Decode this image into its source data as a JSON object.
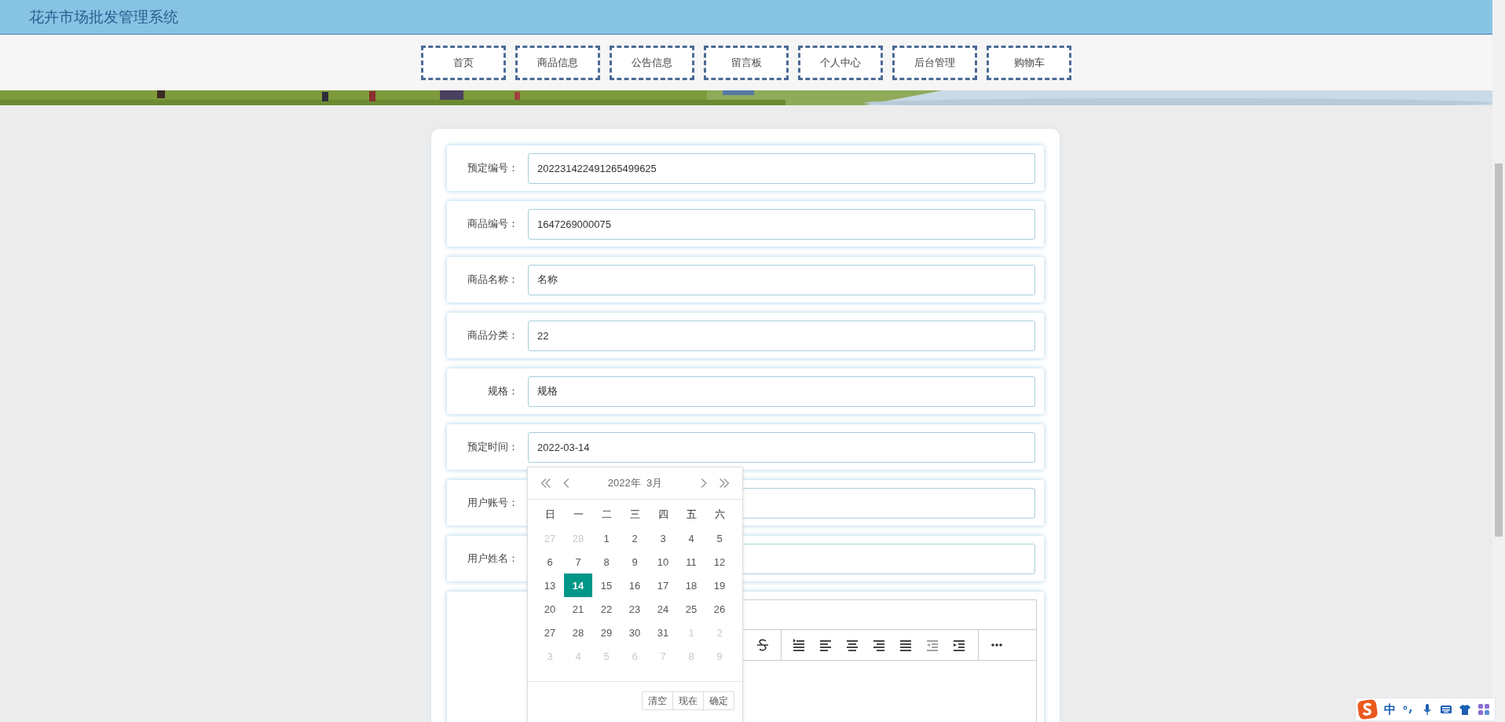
{
  "header": {
    "title": "花卉市场批发管理系统"
  },
  "nav": [
    {
      "label": "首页"
    },
    {
      "label": "商品信息"
    },
    {
      "label": "公告信息"
    },
    {
      "label": "留言板"
    },
    {
      "label": "个人中心"
    },
    {
      "label": "后台管理"
    },
    {
      "label": "购物车"
    }
  ],
  "form": {
    "fields": [
      {
        "label": "预定编号：",
        "value": "202231422491265499625"
      },
      {
        "label": "商品编号：",
        "value": "1647269000075"
      },
      {
        "label": "商品名称：",
        "value": "名称"
      },
      {
        "label": "商品分类：",
        "value": "22"
      },
      {
        "label": "规格：",
        "value": "规格"
      },
      {
        "label": "预定时间：",
        "value": "2022-03-14"
      },
      {
        "label": "用户账号："
      },
      {
        "label": "用户姓名："
      }
    ]
  },
  "date_picker": {
    "year_month": "2022年  3月",
    "weekdays": [
      "日",
      "一",
      "二",
      "三",
      "四",
      "五",
      "六"
    ],
    "days": [
      {
        "day": "27",
        "kind": "other",
        "selected": false
      },
      {
        "day": "28",
        "kind": "other",
        "selected": false
      },
      {
        "day": "1",
        "kind": "current",
        "selected": false
      },
      {
        "day": "2",
        "kind": "current",
        "selected": false
      },
      {
        "day": "3",
        "kind": "current",
        "selected": false
      },
      {
        "day": "4",
        "kind": "current",
        "selected": false
      },
      {
        "day": "5",
        "kind": "current",
        "selected": false
      },
      {
        "day": "6",
        "kind": "current",
        "selected": false
      },
      {
        "day": "7",
        "kind": "current",
        "selected": false
      },
      {
        "day": "8",
        "kind": "current",
        "selected": false
      },
      {
        "day": "9",
        "kind": "current",
        "selected": false
      },
      {
        "day": "10",
        "kind": "current",
        "selected": false
      },
      {
        "day": "11",
        "kind": "current",
        "selected": false
      },
      {
        "day": "12",
        "kind": "current",
        "selected": false
      },
      {
        "day": "13",
        "kind": "current",
        "selected": false
      },
      {
        "day": "14",
        "kind": "current",
        "selected": true
      },
      {
        "day": "15",
        "kind": "current",
        "selected": false
      },
      {
        "day": "16",
        "kind": "current",
        "selected": false
      },
      {
        "day": "17",
        "kind": "current",
        "selected": false
      },
      {
        "day": "18",
        "kind": "current",
        "selected": false
      },
      {
        "day": "19",
        "kind": "current",
        "selected": false
      },
      {
        "day": "20",
        "kind": "current",
        "selected": false
      },
      {
        "day": "21",
        "kind": "current",
        "selected": false
      },
      {
        "day": "22",
        "kind": "current",
        "selected": false
      },
      {
        "day": "23",
        "kind": "current",
        "selected": false
      },
      {
        "day": "24",
        "kind": "current",
        "selected": false
      },
      {
        "day": "25",
        "kind": "current",
        "selected": false
      },
      {
        "day": "26",
        "kind": "current",
        "selected": false
      },
      {
        "day": "27",
        "kind": "current",
        "selected": false
      },
      {
        "day": "28",
        "kind": "current",
        "selected": false
      },
      {
        "day": "29",
        "kind": "current",
        "selected": false
      },
      {
        "day": "30",
        "kind": "current",
        "selected": false
      },
      {
        "day": "31",
        "kind": "current",
        "selected": false
      },
      {
        "day": "1",
        "kind": "other",
        "selected": false
      },
      {
        "day": "2",
        "kind": "other",
        "selected": false
      },
      {
        "day": "3",
        "kind": "other",
        "selected": false
      },
      {
        "day": "4",
        "kind": "other",
        "selected": false
      },
      {
        "day": "5",
        "kind": "other",
        "selected": false
      },
      {
        "day": "6",
        "kind": "other",
        "selected": false
      },
      {
        "day": "7",
        "kind": "other",
        "selected": false
      },
      {
        "day": "8",
        "kind": "other",
        "selected": false
      },
      {
        "day": "9",
        "kind": "other",
        "selected": false
      }
    ],
    "buttons": [
      "清空",
      "现在",
      "确定"
    ]
  },
  "ime": {
    "mode": "中"
  }
}
